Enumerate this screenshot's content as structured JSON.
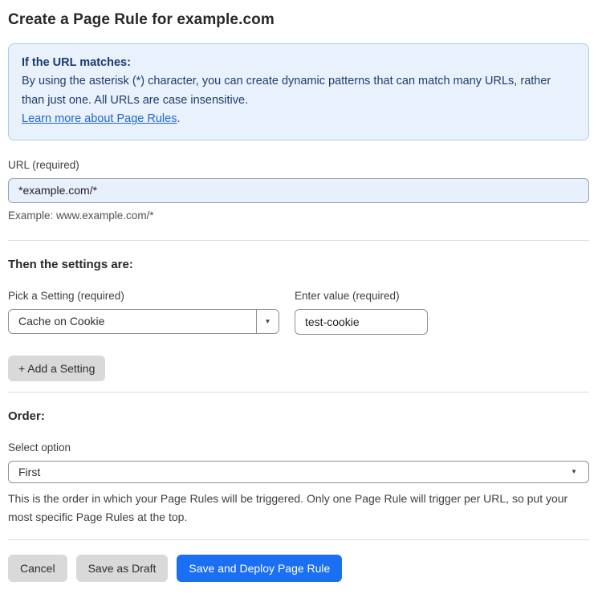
{
  "page": {
    "title": "Create a Page Rule for example.com"
  },
  "info_box": {
    "heading": "If the URL matches:",
    "body": "By using the asterisk (*) character, you can create dynamic patterns that can match many URLs, rather than just one. All URLs are case insensitive.",
    "link_label": "Learn more about Page Rules",
    "link_suffix": "."
  },
  "url_field": {
    "label": "URL (required)",
    "value": "*example.com/*",
    "helper": "Example: www.example.com/*"
  },
  "settings": {
    "heading": "Then the settings are:",
    "setting_label": "Pick a Setting (required)",
    "setting_value": "Cache on Cookie",
    "value_label": "Enter value (required)",
    "value_value": "test-cookie",
    "add_button_label": "+ Add a Setting"
  },
  "order": {
    "heading": "Order:",
    "select_label": "Select option",
    "select_value": "First",
    "helper": "This is the order in which your Page Rules will be triggered. Only one Page Rule will trigger per URL, so put your most specific Page Rules at the top."
  },
  "actions": {
    "cancel_label": "Cancel",
    "save_draft_label": "Save as Draft",
    "save_deploy_label": "Save and Deploy Page Rule"
  },
  "icons": {
    "dropdown_arrow": "▼"
  },
  "colors": {
    "info_bg": "#e9f2fc",
    "info_border": "#abcbec",
    "info_text": "#1e3c6e",
    "link_blue": "#2166cf",
    "autofill_input_bg": "#e8f0fe",
    "primary_button_blue": "#1b6ff2",
    "gray_button": "#d9d9d9"
  }
}
